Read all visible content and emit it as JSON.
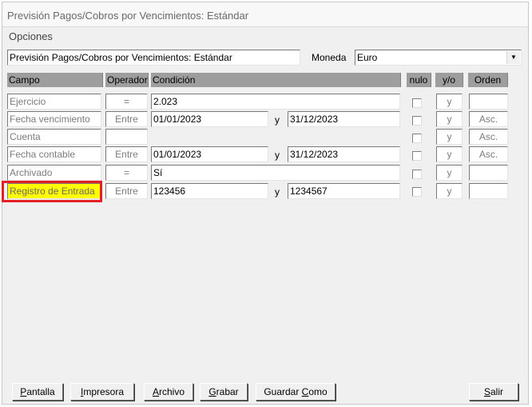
{
  "window": {
    "title": "Previsión Pagos/Cobros por Vencimientos: Estándar",
    "menu": "Opciones"
  },
  "top": {
    "name_value": "Previsión Pagos/Cobros por Vencimientos: Estándar",
    "currency_label": "Moneda",
    "currency_value": "Euro"
  },
  "headers": {
    "campo": "Campo",
    "operador": "Operador",
    "condicion": "Condición",
    "nulo": "nulo",
    "yo": "y/o",
    "orden": "Orden"
  },
  "rows": [
    {
      "campo": "Ejercicio",
      "operador": "=",
      "valor1": "2.023",
      "sep": "",
      "valor2": "",
      "yo": "y",
      "orden": ""
    },
    {
      "campo": "Fecha vencimiento",
      "operador": "Entre",
      "valor1": "01/01/2023",
      "sep": "y",
      "valor2": "31/12/2023",
      "yo": "y",
      "orden": "Asc."
    },
    {
      "campo": "Cuenta",
      "operador": "",
      "valor1": "",
      "sep": "",
      "valor2": "",
      "yo": "y",
      "orden": "Asc."
    },
    {
      "campo": "Fecha contable",
      "operador": "Entre",
      "valor1": "01/01/2023",
      "sep": "y",
      "valor2": "31/12/2023",
      "yo": "y",
      "orden": "Asc."
    },
    {
      "campo": "Archivado",
      "operador": "=",
      "valor1": "Sí",
      "sep": "",
      "valor2": "",
      "yo": "y",
      "orden": ""
    },
    {
      "campo": "Registro de Entrada",
      "operador": "Entre",
      "valor1": "123456",
      "sep": "y",
      "valor2": "1234567",
      "yo": "y",
      "orden": ""
    }
  ],
  "buttons": {
    "pantalla": {
      "ul": "P",
      "rest": "antalla"
    },
    "impresora": {
      "ul": "I",
      "rest": "mpresora"
    },
    "archivo": {
      "ul": "A",
      "rest": "rchivo"
    },
    "grabar": {
      "ul": "G",
      "rest": "rabar"
    },
    "guardar_pre": "Guardar ",
    "guardar_ul": "C",
    "guardar_rest": "omo",
    "salir": {
      "ul": "S",
      "rest": "alir"
    }
  }
}
